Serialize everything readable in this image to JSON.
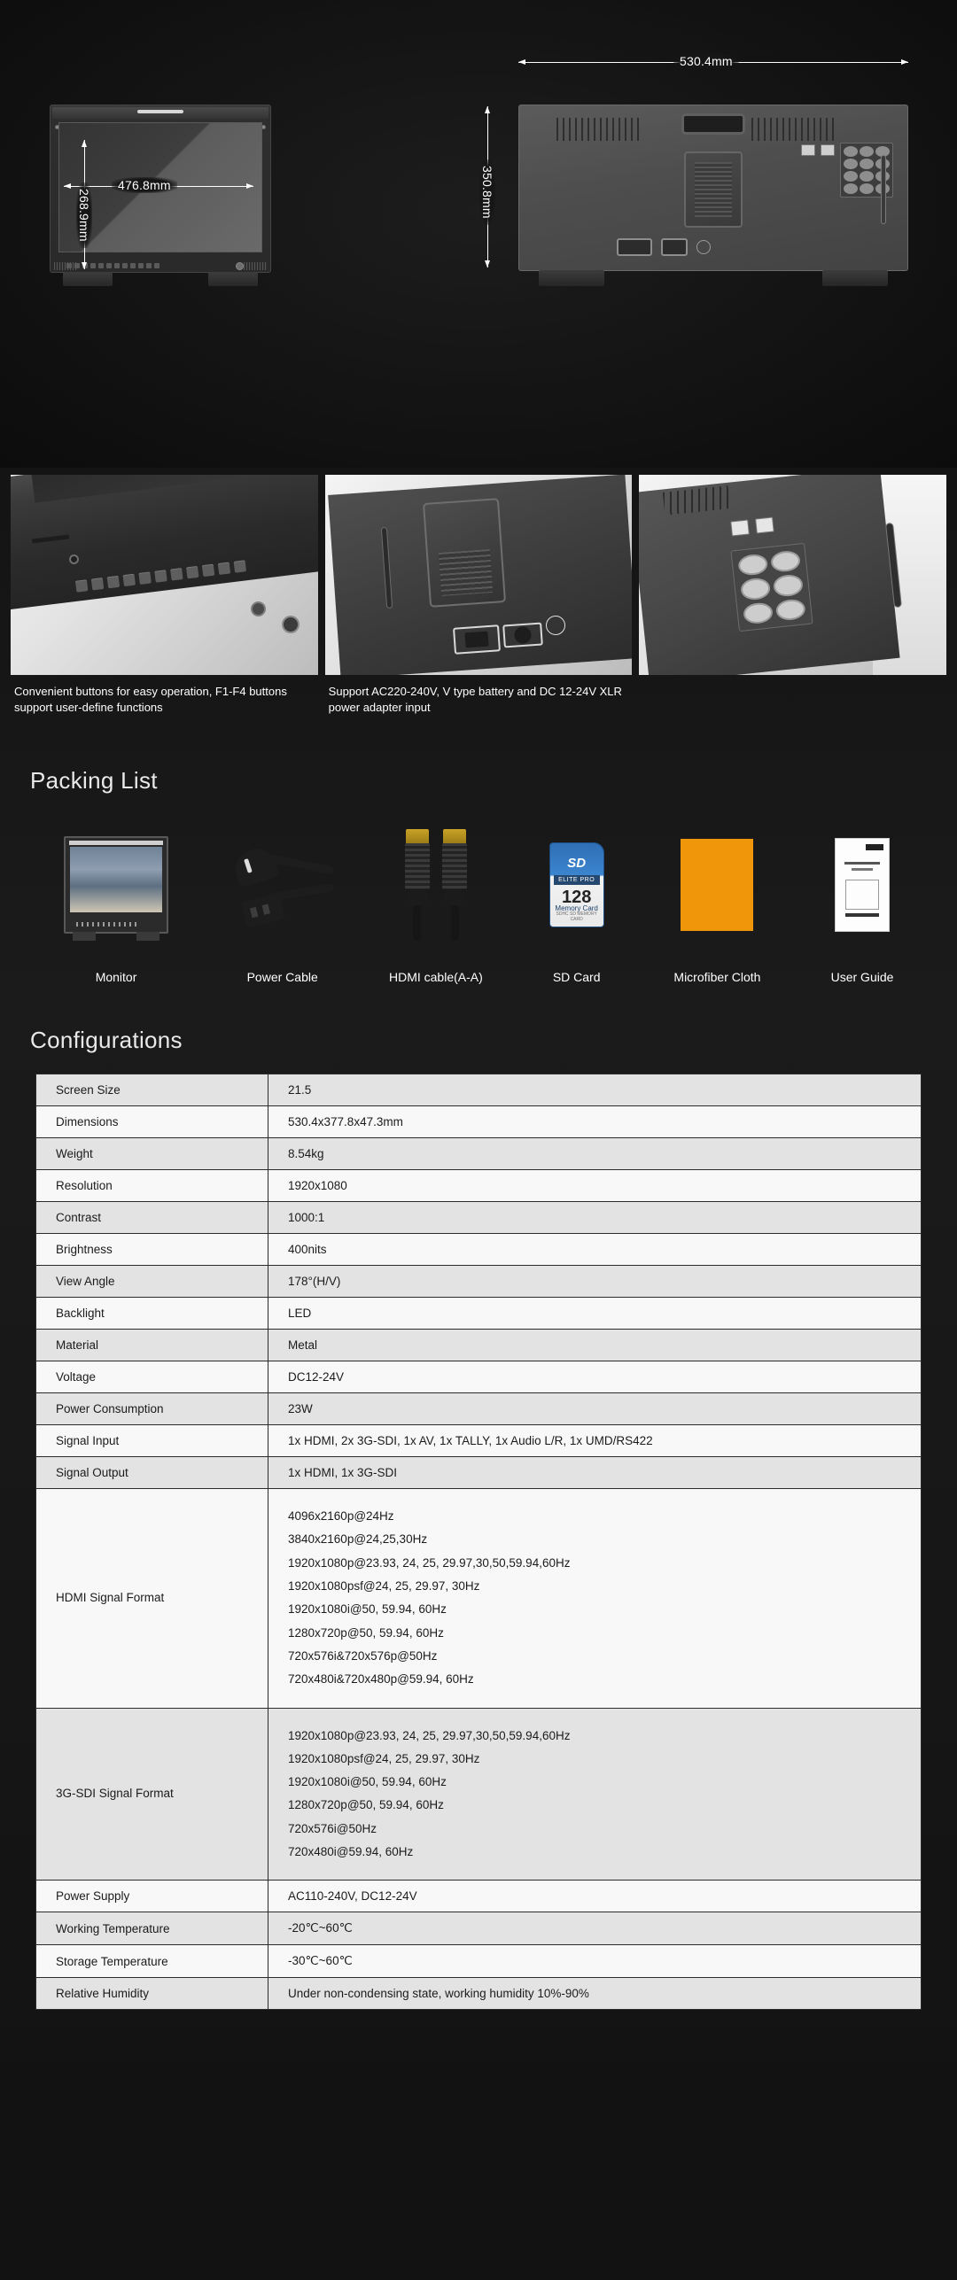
{
  "dimensions_section": {
    "front_view": {
      "width_label": "476.8mm",
      "height_label": "268.9mm"
    },
    "back_view": {
      "width_label": "530.4mm",
      "height_label": "350.8mm"
    }
  },
  "features": [
    {
      "image_name": "button-panel-photo",
      "caption": "Convenient buttons for easy operation, F1-F4 buttons support user-define functions"
    },
    {
      "image_name": "v-mount-back-photo",
      "caption": "Support AC220-240V, V type battery and DC 12-24V XLR power adapter input"
    },
    {
      "image_name": "ports-closeup-photo",
      "caption": ""
    }
  ],
  "packing": {
    "title": "Packing List",
    "items": [
      {
        "label": "Monitor",
        "icon": "monitor-icon"
      },
      {
        "label": "Power Cable",
        "icon": "power-cable-icon"
      },
      {
        "label": "HDMI cable(A-A)",
        "icon": "hdmi-cable-icon"
      },
      {
        "label": "SD Card",
        "icon": "sd-card-icon"
      },
      {
        "label": "Microfiber Cloth",
        "icon": "microfiber-cloth-icon"
      },
      {
        "label": "User Guide",
        "icon": "user-guide-icon"
      }
    ],
    "sd_card": {
      "brand": "SD",
      "tier": "ELITE PRO",
      "capacity": "128",
      "memory_text": "Memory Card",
      "fine_print": "SDHC SD MEMORY CARD"
    },
    "cloth_color": "#f0960a"
  },
  "configurations": {
    "title": "Configurations",
    "rows": [
      {
        "key": "Screen Size",
        "value": "21.5"
      },
      {
        "key": "Dimensions",
        "value": "530.4x377.8x47.3mm"
      },
      {
        "key": "Weight",
        "value": "8.54kg"
      },
      {
        "key": "Resolution",
        "value": "1920x1080"
      },
      {
        "key": "Contrast",
        "value": "1000:1"
      },
      {
        "key": "Brightness",
        "value": "400nits"
      },
      {
        "key": "View Angle",
        "value": "178°(H/V)"
      },
      {
        "key": "Backlight",
        "value": "LED"
      },
      {
        "key": "Material",
        "value": "Metal"
      },
      {
        "key": "Voltage",
        "value": "DC12-24V"
      },
      {
        "key": "Power Consumption",
        "value": "23W"
      },
      {
        "key": "Signal Input",
        "value": "1x HDMI, 2x 3G-SDI, 1x AV, 1x TALLY, 1x Audio L/R, 1x UMD/RS422"
      },
      {
        "key": "Signal Output",
        "value": "1x HDMI, 1x 3G-SDI"
      },
      {
        "key": "HDMI Signal Format",
        "value": "4096x2160p@24Hz\n3840x2160p@24,25,30Hz\n1920x1080p@23.93, 24, 25, 29.97,30,50,59.94,60Hz\n1920x1080psf@24, 25, 29.97, 30Hz\n1920x1080i@50, 59.94, 60Hz\n1280x720p@50, 59.94, 60Hz\n720x576i&720x576p@50Hz\n720x480i&720x480p@59.94, 60Hz"
      },
      {
        "key": "3G-SDI Signal Format",
        "value": "1920x1080p@23.93, 24, 25, 29.97,30,50,59.94,60Hz\n1920x1080psf@24, 25, 29.97, 30Hz\n1920x1080i@50, 59.94, 60Hz\n1280x720p@50, 59.94, 60Hz\n720x576i@50Hz\n720x480i@59.94, 60Hz"
      },
      {
        "key": "Power Supply",
        "value": "AC110-240V, DC12-24V"
      },
      {
        "key": "Working Temperature",
        "value": "-20℃~60℃"
      },
      {
        "key": "Storage Temperature",
        "value": "-30℃~60℃"
      },
      {
        "key": "Relative Humidity",
        "value": "Under non-condensing state, working humidity 10%-90%"
      }
    ]
  }
}
